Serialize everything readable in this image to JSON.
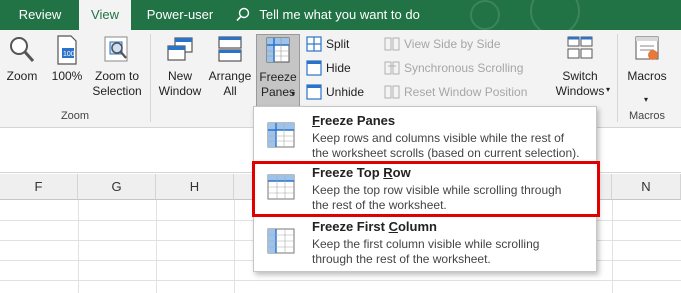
{
  "tabs": {
    "review": "Review",
    "view": "View",
    "power_user": "Power-user",
    "tell_me": "Tell me what you want to do"
  },
  "ribbon": {
    "zoom_group": {
      "zoom": "Zoom",
      "hundred": "100%",
      "zoom_to_selection": "Zoom to\nSelection",
      "label": "Zoom"
    },
    "window_group": {
      "new_window": "New\nWindow",
      "arrange_all": "Arrange\nAll",
      "freeze_panes": "Freeze\nPanes",
      "split": "Split",
      "hide": "Hide",
      "unhide": "Unhide",
      "view_side_by_side": "View Side by Side",
      "synchronous_scrolling": "Synchronous Scrolling",
      "reset_window_position": "Reset Window Position",
      "switch_windows": "Switch\nWindows"
    },
    "macros_group": {
      "macros": "Macros",
      "label": "Macros"
    }
  },
  "columns": [
    "F",
    "G",
    "H",
    "N"
  ],
  "freeze_menu": {
    "items": [
      {
        "title_pre": "",
        "title_ul": "F",
        "title_post": "reeze Panes",
        "description": "Keep rows and columns visible while the rest of\nthe worksheet scrolls (based on current selection)."
      },
      {
        "title_pre": "Freeze Top ",
        "title_ul": "R",
        "title_post": "ow",
        "description": "Keep the top row visible while scrolling through\nthe rest of the worksheet."
      },
      {
        "title_pre": "Freeze First ",
        "title_ul": "C",
        "title_post": "olumn",
        "description": "Keep the first column visible while scrolling\nthrough the rest of the worksheet."
      }
    ]
  },
  "colors": {
    "excel_green": "#217346",
    "highlight_red": "#e00000"
  }
}
